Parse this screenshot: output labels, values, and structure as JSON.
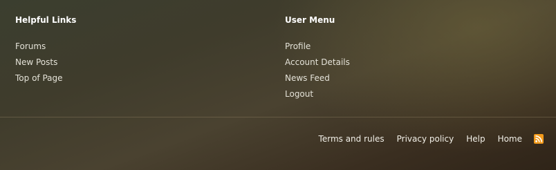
{
  "helpful_links": {
    "title": "Helpful Links",
    "items": [
      "Forums",
      "New Posts",
      "Top of Page"
    ]
  },
  "user_menu": {
    "title": "User Menu",
    "items": [
      "Profile",
      "Account Details",
      "News Feed",
      "Logout"
    ]
  },
  "bottom_links": {
    "terms": "Terms and rules",
    "privacy": "Privacy policy",
    "help": "Help",
    "home": "Home",
    "rss_icon": "rss-icon"
  },
  "colors": {
    "rss_orange": "#f29a1b",
    "link_text": "#e4e2d8",
    "heading_text": "#ffffff"
  }
}
